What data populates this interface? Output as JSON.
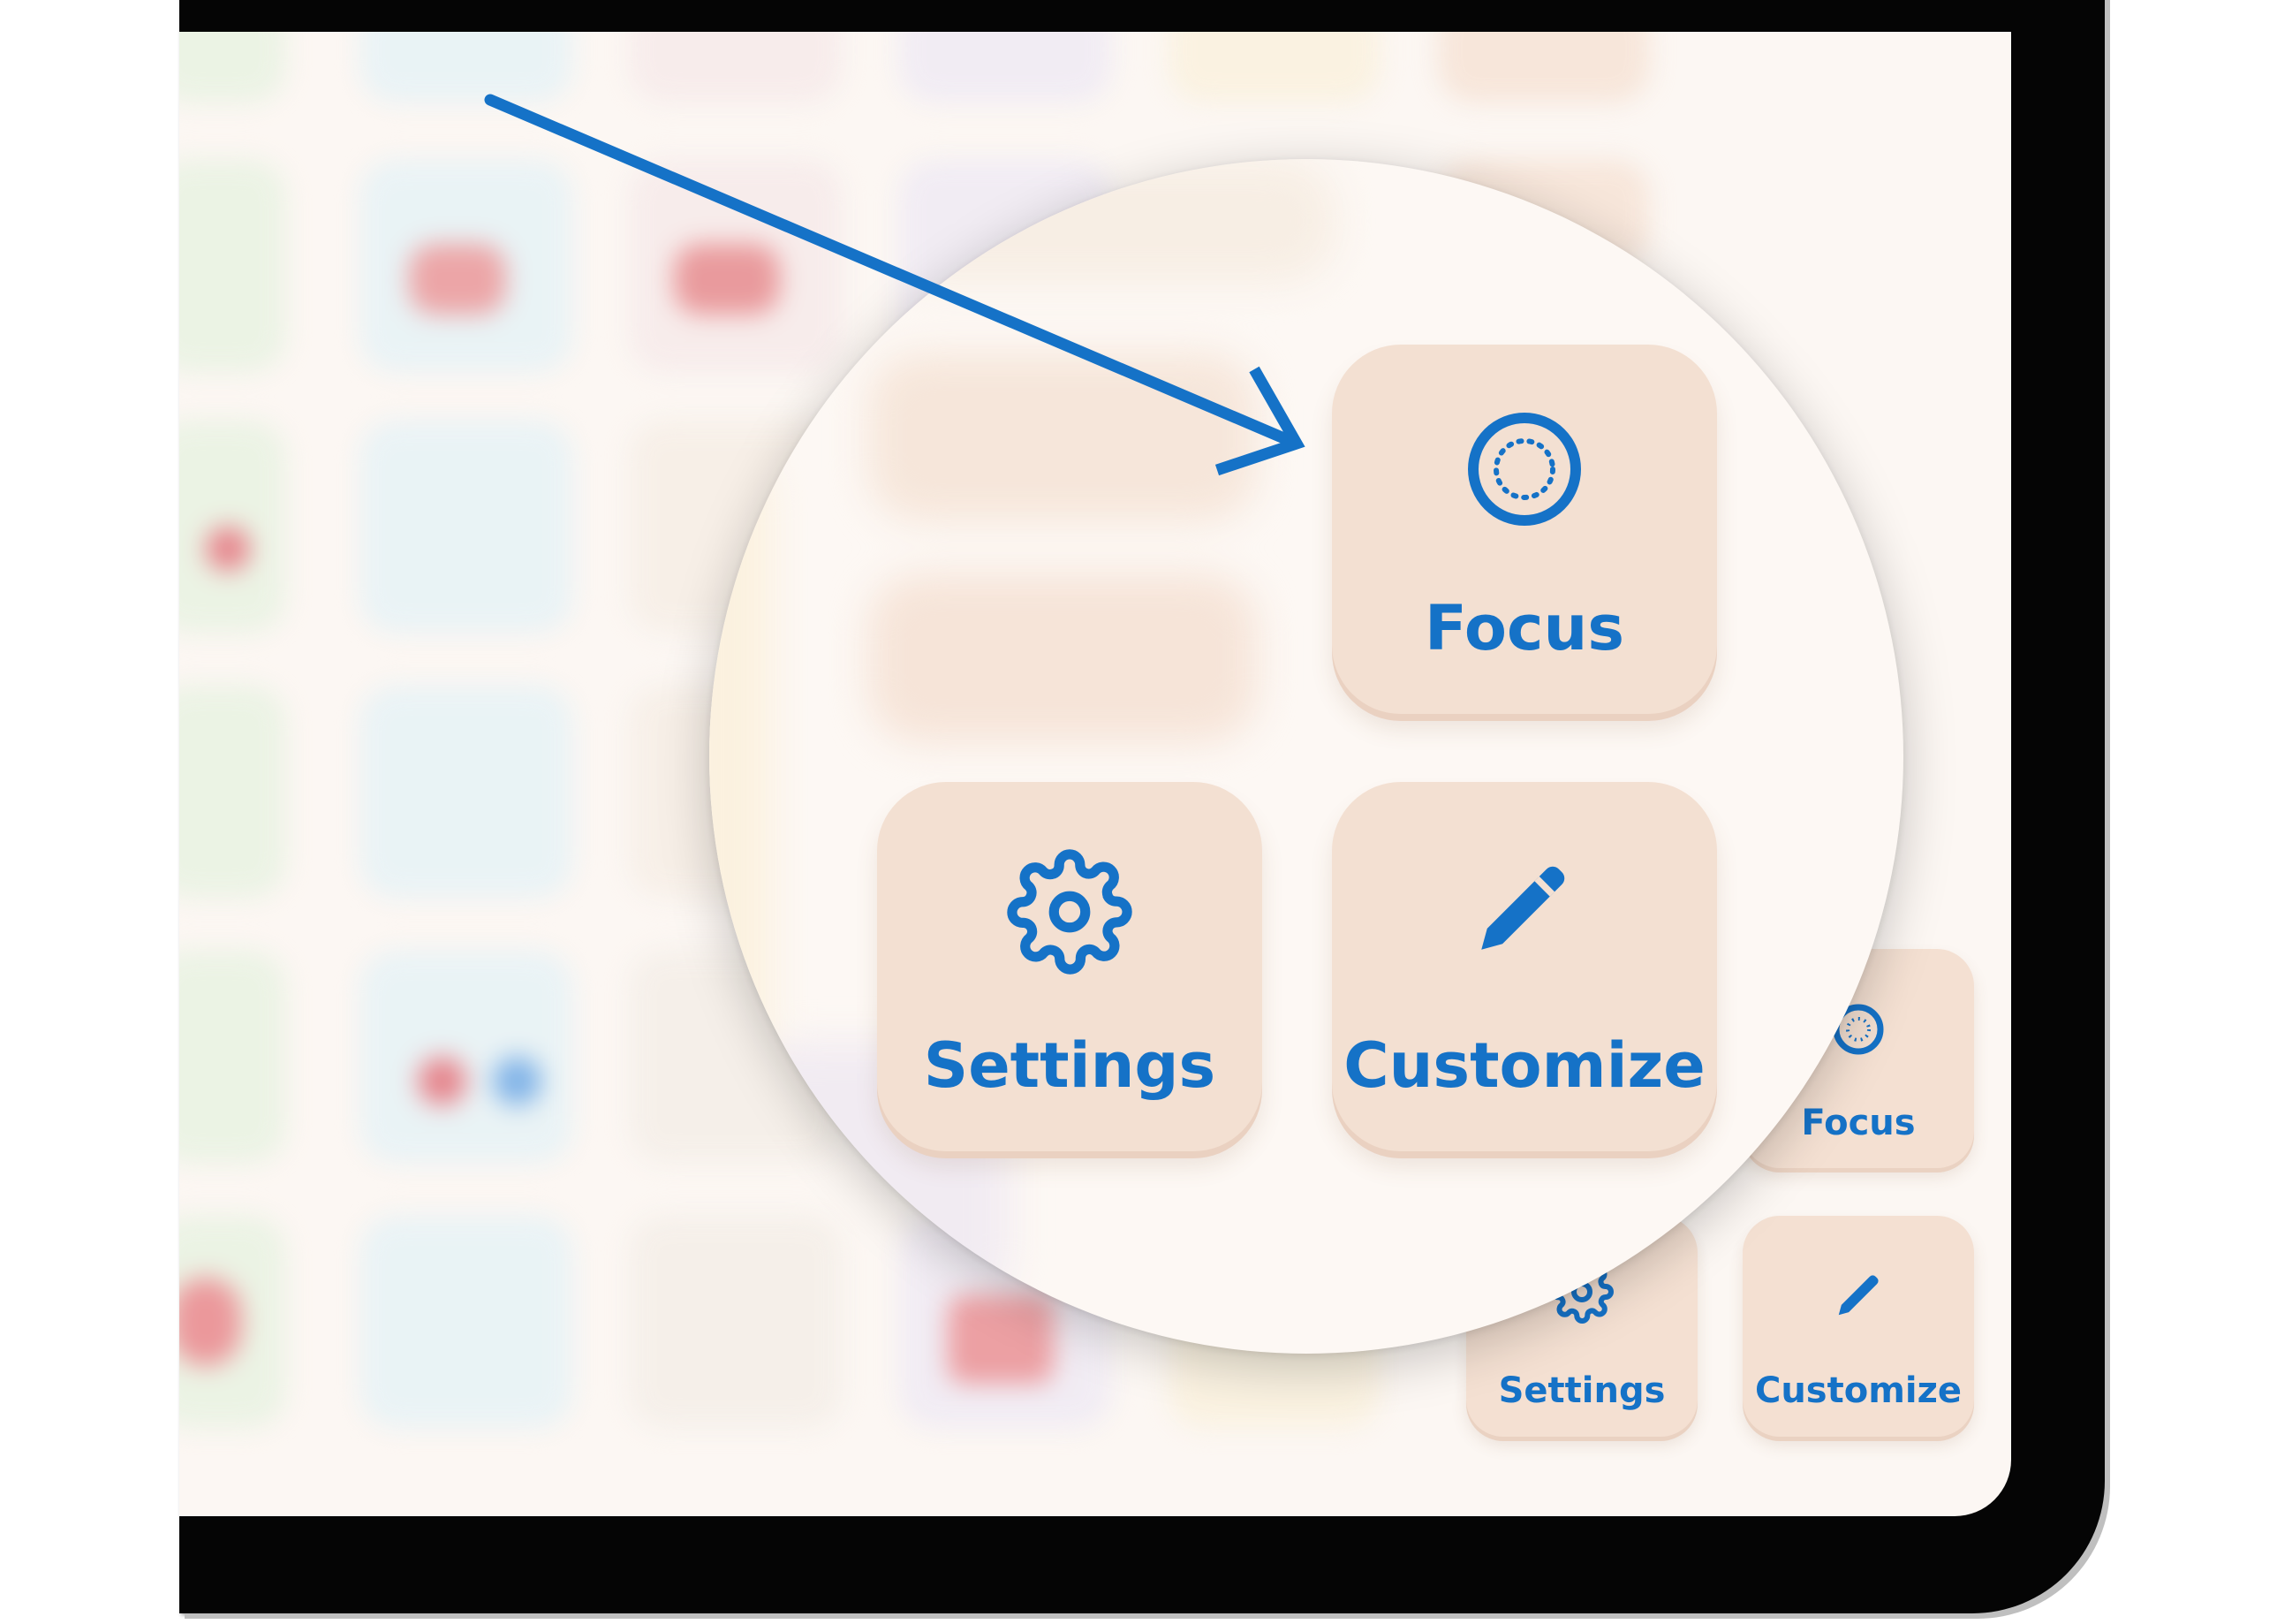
{
  "colors": {
    "accent": "#1572c7",
    "tile_background": "#f3e0d2",
    "screen_background": "#fcf7f3",
    "bezel": "#050505"
  },
  "magnified": {
    "focus": {
      "label": "Focus",
      "icon": "focus-circle-icon"
    },
    "settings": {
      "label": "Settings",
      "icon": "gear-icon"
    },
    "customize": {
      "label": "Customize",
      "icon": "pencil-icon"
    }
  },
  "corner_buttons": {
    "focus": {
      "label": "Focus",
      "icon": "focus-circle-icon"
    },
    "settings": {
      "label": "Settings",
      "icon": "gear-icon"
    },
    "customize": {
      "label": "Customize",
      "icon": "pencil-icon"
    }
  },
  "annotation": {
    "icon": "pointer-arrow-icon"
  }
}
